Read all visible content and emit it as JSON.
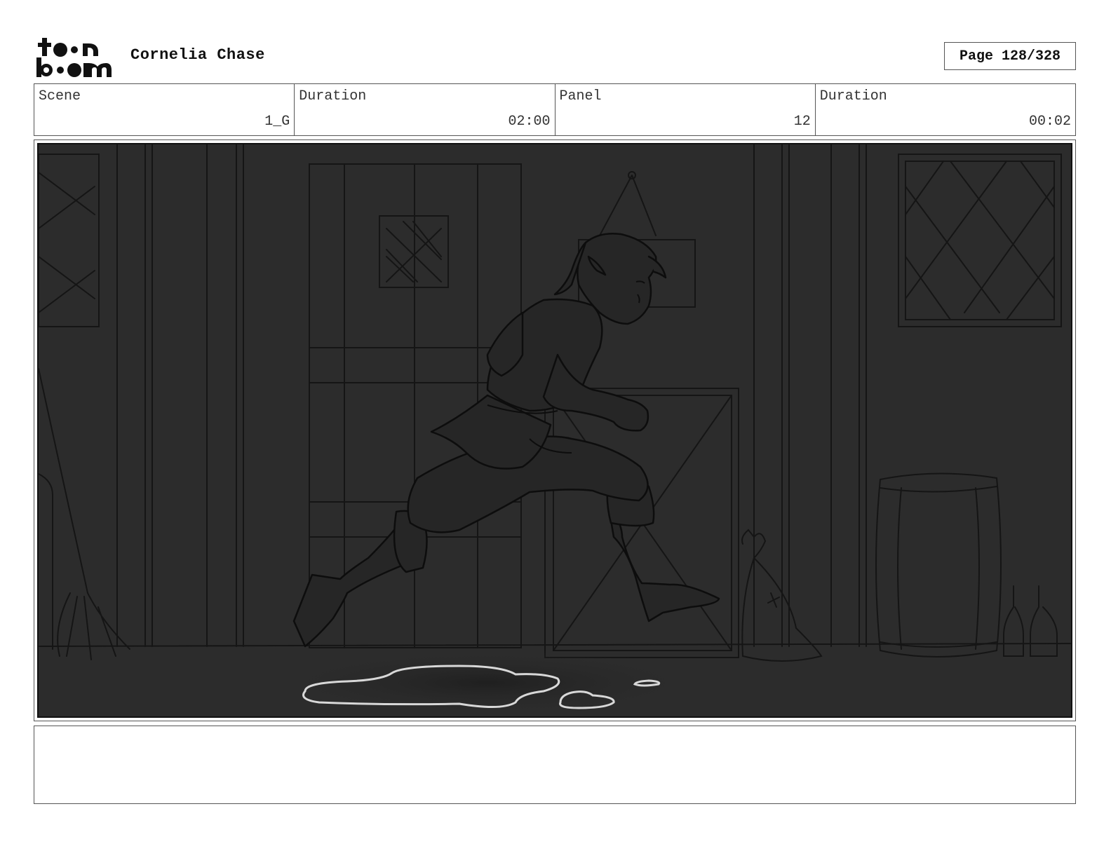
{
  "header": {
    "logo_name": "toon-boom-logo",
    "project_title": "Cornelia Chase",
    "page_label": "Page 128/328"
  },
  "info": [
    {
      "label": "Scene",
      "value": "1_G"
    },
    {
      "label": "Duration",
      "value": "02:00"
    },
    {
      "label": "Panel",
      "value": "12"
    },
    {
      "label": "Duration",
      "value": "00:02"
    }
  ],
  "notes": {
    "text": ""
  },
  "colors": {
    "panel_bg": "#2c2c2c",
    "line": "#111111",
    "puddle": "#d8d8d8"
  }
}
